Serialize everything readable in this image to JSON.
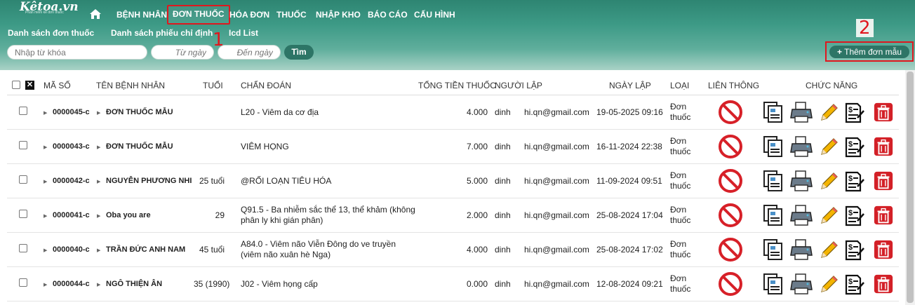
{
  "app": {
    "logo": "Kêtoa.vn",
    "logo_sub": "Phần mềm kê đơn thuốc"
  },
  "nav": {
    "items": [
      {
        "label": "BỆNH NHÂN"
      },
      {
        "label": "ĐƠN THUỐC",
        "active": true
      },
      {
        "label": "HÓA ĐƠN"
      },
      {
        "label": "THUỐC"
      },
      {
        "label": "NHẬP KHO"
      },
      {
        "label": "BÁO CÁO"
      },
      {
        "label": "CẤU HÌNH"
      }
    ]
  },
  "subnav": {
    "items": [
      {
        "label": "Danh sách đơn thuốc"
      },
      {
        "label": "Danh sách phiếu chỉ định"
      },
      {
        "label": "Icd List"
      }
    ]
  },
  "markers": {
    "one": "1",
    "two": "2"
  },
  "search": {
    "keyword_placeholder": "Nhập từ khóa",
    "from_placeholder": "Từ ngày",
    "to_placeholder": "Đến ngày",
    "button": "Tìm"
  },
  "add_button": {
    "label": "Thêm đơn mẫu"
  },
  "table": {
    "headers": {
      "code": "MÃ SỐ",
      "patient": "TÊN BỆNH NHÂN",
      "age": "TUỔI",
      "diagnosis": "CHẨN ĐOÁN",
      "total": "TỔNG TIỀN THUỐC",
      "creator": "NGƯỜI LẬP",
      "date": "NGÀY LẬP",
      "type": "LOẠI",
      "connect": "LIÊN THÔNG",
      "actions": "CHỨC NĂNG"
    },
    "rows": [
      {
        "code": "0000045-c",
        "patient": "ĐƠN THUỐC MẪU",
        "age": "",
        "diagnosis": "L20 - Viêm da cơ địa",
        "total": "4.000",
        "creator_a": "dinh",
        "creator_b": "hi.qn@gmail.com",
        "date": "19-05-2025 09:16",
        "type": "Đơn thuốc"
      },
      {
        "code": "0000043-c",
        "patient": "ĐƠN THUỐC MẪU",
        "age": "",
        "diagnosis": "VIÊM HỌNG",
        "total": "7.000",
        "creator_a": "dinh",
        "creator_b": "hi.qn@gmail.com",
        "date": "16-11-2024 22:38",
        "type": "Đơn thuốc"
      },
      {
        "code": "0000042-c",
        "patient": "NGUYỄN PHƯƠNG NHI",
        "age": "25 tuổi",
        "diagnosis": "@RỐI LOẠN TIÊU HÓA",
        "total": "5.000",
        "creator_a": "dinh",
        "creator_b": "hi.qn@gmail.com",
        "date": "11-09-2024 09:51",
        "type": "Đơn thuốc"
      },
      {
        "code": "0000041-c",
        "patient": "Oba you are",
        "age": "29",
        "diagnosis": "Q91.5 - Ba nhiễm sắc thể 13, thể khảm (không phân ly khi gián phân)",
        "total": "2.000",
        "creator_a": "dinh",
        "creator_b": "hi.qn@gmail.com",
        "date": "25-08-2024 17:04",
        "type": "Đơn thuốc"
      },
      {
        "code": "0000040-c",
        "patient": "TRẦN ĐỨC ANH NAM",
        "age": "45 tuổi",
        "diagnosis": "A84.0 - Viêm não Viễn Đông do ve truyền (viêm não xuân hè Nga)",
        "total": "4.000",
        "creator_a": "dinh",
        "creator_b": "hi.qn@gmail.com",
        "date": "25-08-2024 17:02",
        "type": "Đơn thuốc"
      },
      {
        "code": "0000044-c",
        "patient": "NGÔ THIỆN ÂN",
        "age": "35 (1990)",
        "diagnosis": "J02 - Viêm họng cấp",
        "total": "0.000",
        "creator_a": "dinh",
        "creator_b": "hi.qn@gmail.com",
        "date": "12-08-2024 09:21",
        "type": "Đơn thuốc"
      }
    ]
  },
  "colors": {
    "brand": "#2e8572",
    "button": "#2d7566",
    "highlight": "#e0171e"
  }
}
